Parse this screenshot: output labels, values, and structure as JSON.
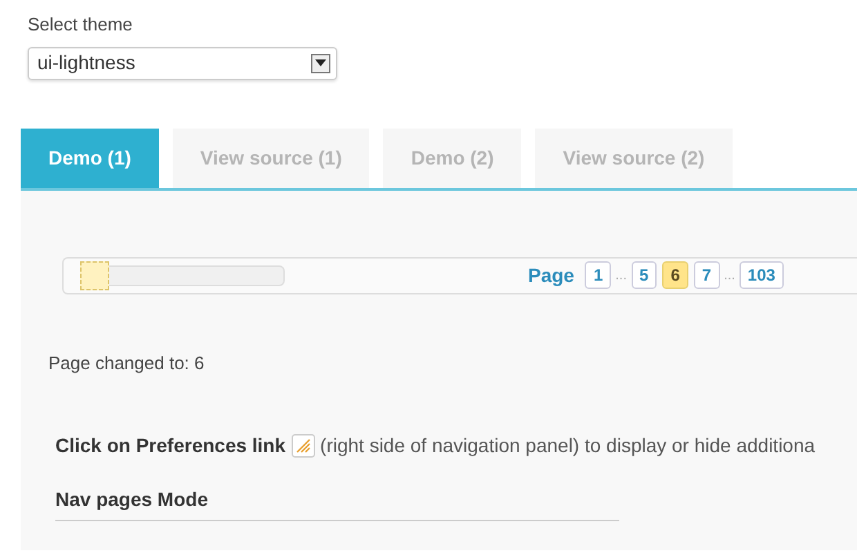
{
  "theme_select": {
    "label": "Select theme",
    "value": "ui-lightness"
  },
  "tabs": [
    {
      "label": "Demo (1)",
      "selected": true
    },
    {
      "label": "View source (1)",
      "selected": false
    },
    {
      "label": "Demo (2)",
      "selected": false
    },
    {
      "label": "View source (2)",
      "selected": false
    }
  ],
  "pager": {
    "slider": {
      "level": 0
    },
    "label": "Page",
    "items": [
      {
        "kind": "page",
        "label": "1",
        "selected": false
      },
      {
        "kind": "gap",
        "label": "..."
      },
      {
        "kind": "page",
        "label": "5",
        "selected": false
      },
      {
        "kind": "page",
        "label": "6",
        "selected": true
      },
      {
        "kind": "page",
        "label": "7",
        "selected": false
      },
      {
        "kind": "gap",
        "label": "..."
      },
      {
        "kind": "page",
        "label": "103",
        "selected": false
      }
    ]
  },
  "status": "Page changed to: 6",
  "hint": {
    "label": "Click on Preferences link",
    "text": "(right side of navigation panel) to display or hide additiona"
  },
  "section_title": "Nav pages Mode"
}
